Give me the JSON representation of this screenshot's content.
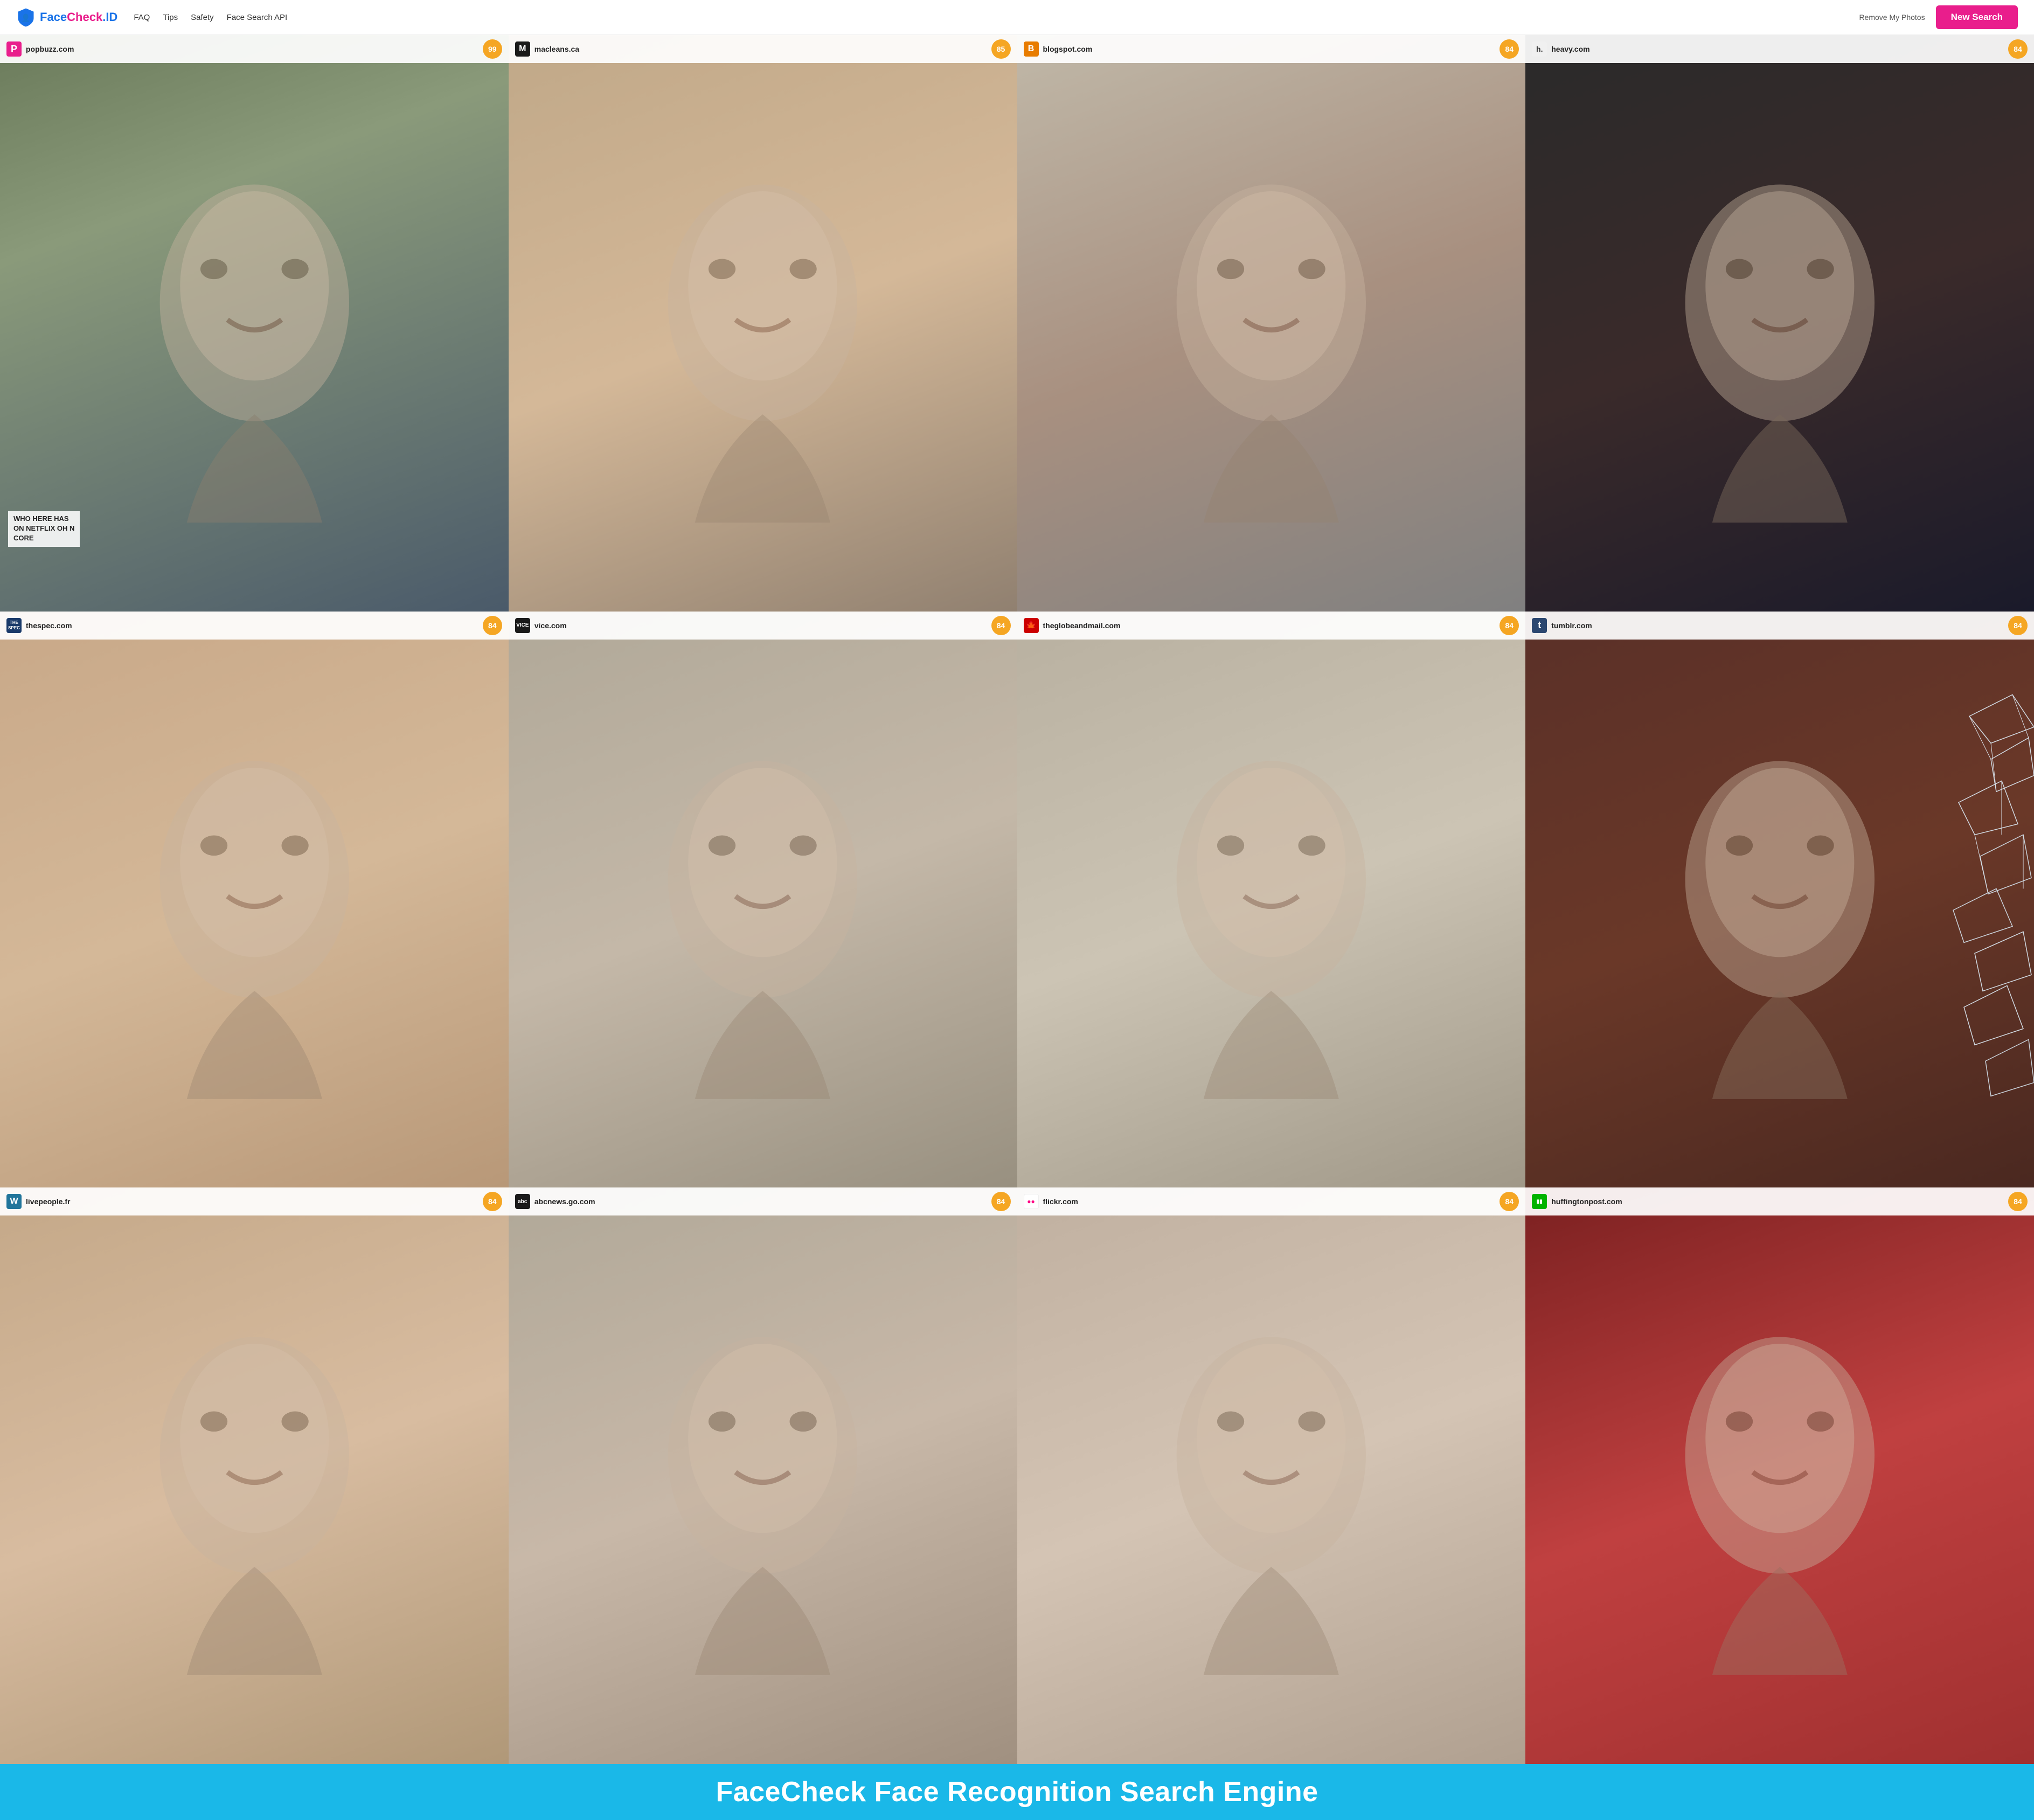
{
  "header": {
    "logo": {
      "text": "FaceCheck.ID",
      "face_part": "Face",
      "check_part": "Check",
      "id_part": ".ID"
    },
    "nav": {
      "faq": "FAQ",
      "tips": "Tips",
      "safety": "Safety",
      "face_search_api": "Face Search API"
    },
    "remove_photos": "Remove My Photos",
    "new_search": "New Search"
  },
  "results": [
    {
      "site": "popbuzz.com",
      "score": 99,
      "favicon_letter": "P",
      "favicon_class": "favicon-popbuzz",
      "img_class": "img-1",
      "overlay_text": "WHO HERE HAS\nON NETFLIX OH N\nCORE"
    },
    {
      "site": "macleans.ca",
      "score": 85,
      "favicon_letter": "M",
      "favicon_class": "favicon-macleans",
      "img_class": "img-2",
      "overlay_text": null
    },
    {
      "site": "blogspot.com",
      "score": 84,
      "favicon_letter": "B",
      "favicon_class": "favicon-blogspot",
      "img_class": "img-3",
      "overlay_text": null
    },
    {
      "site": "heavy.com",
      "score": 84,
      "favicon_letter": "h.",
      "favicon_class": "favicon-heavy",
      "img_class": "img-4",
      "overlay_text": null
    },
    {
      "site": "thespec.com",
      "score": 84,
      "favicon_letter": "THE\nSPEC",
      "favicon_class": "favicon-thespec",
      "img_class": "img-5",
      "overlay_text": null
    },
    {
      "site": "vice.com",
      "score": 84,
      "favicon_letter": "VICE",
      "favicon_class": "favicon-vice",
      "img_class": "img-6",
      "overlay_text": null
    },
    {
      "site": "theglobeandmail.com",
      "score": 84,
      "favicon_letter": "🍁",
      "favicon_class": "favicon-theglobeandmail",
      "img_class": "img-7",
      "overlay_text": null
    },
    {
      "site": "tumblr.com",
      "score": 84,
      "favicon_letter": "t",
      "favicon_class": "favicon-tumblr",
      "img_class": "img-8",
      "overlay_text": null
    },
    {
      "site": "livepeople.fr",
      "score": 84,
      "favicon_letter": "W",
      "favicon_class": "favicon-livepeople",
      "img_class": "img-9",
      "overlay_text": null
    },
    {
      "site": "abcnews.go.com",
      "score": 84,
      "favicon_letter": "abc",
      "favicon_class": "favicon-abcnews",
      "img_class": "img-10",
      "overlay_text": null
    },
    {
      "site": "flickr.com",
      "score": 84,
      "favicon_letter": "●●",
      "favicon_class": "favicon-flickr",
      "img_class": "img-11",
      "overlay_text": null
    },
    {
      "site": "huffingtonpost.com",
      "score": 84,
      "favicon_letter": "HH",
      "favicon_class": "favicon-huffpost",
      "img_class": "img-12",
      "overlay_text": null
    }
  ],
  "footer": {
    "title": "FaceCheck Face Recognition Search Engine"
  }
}
